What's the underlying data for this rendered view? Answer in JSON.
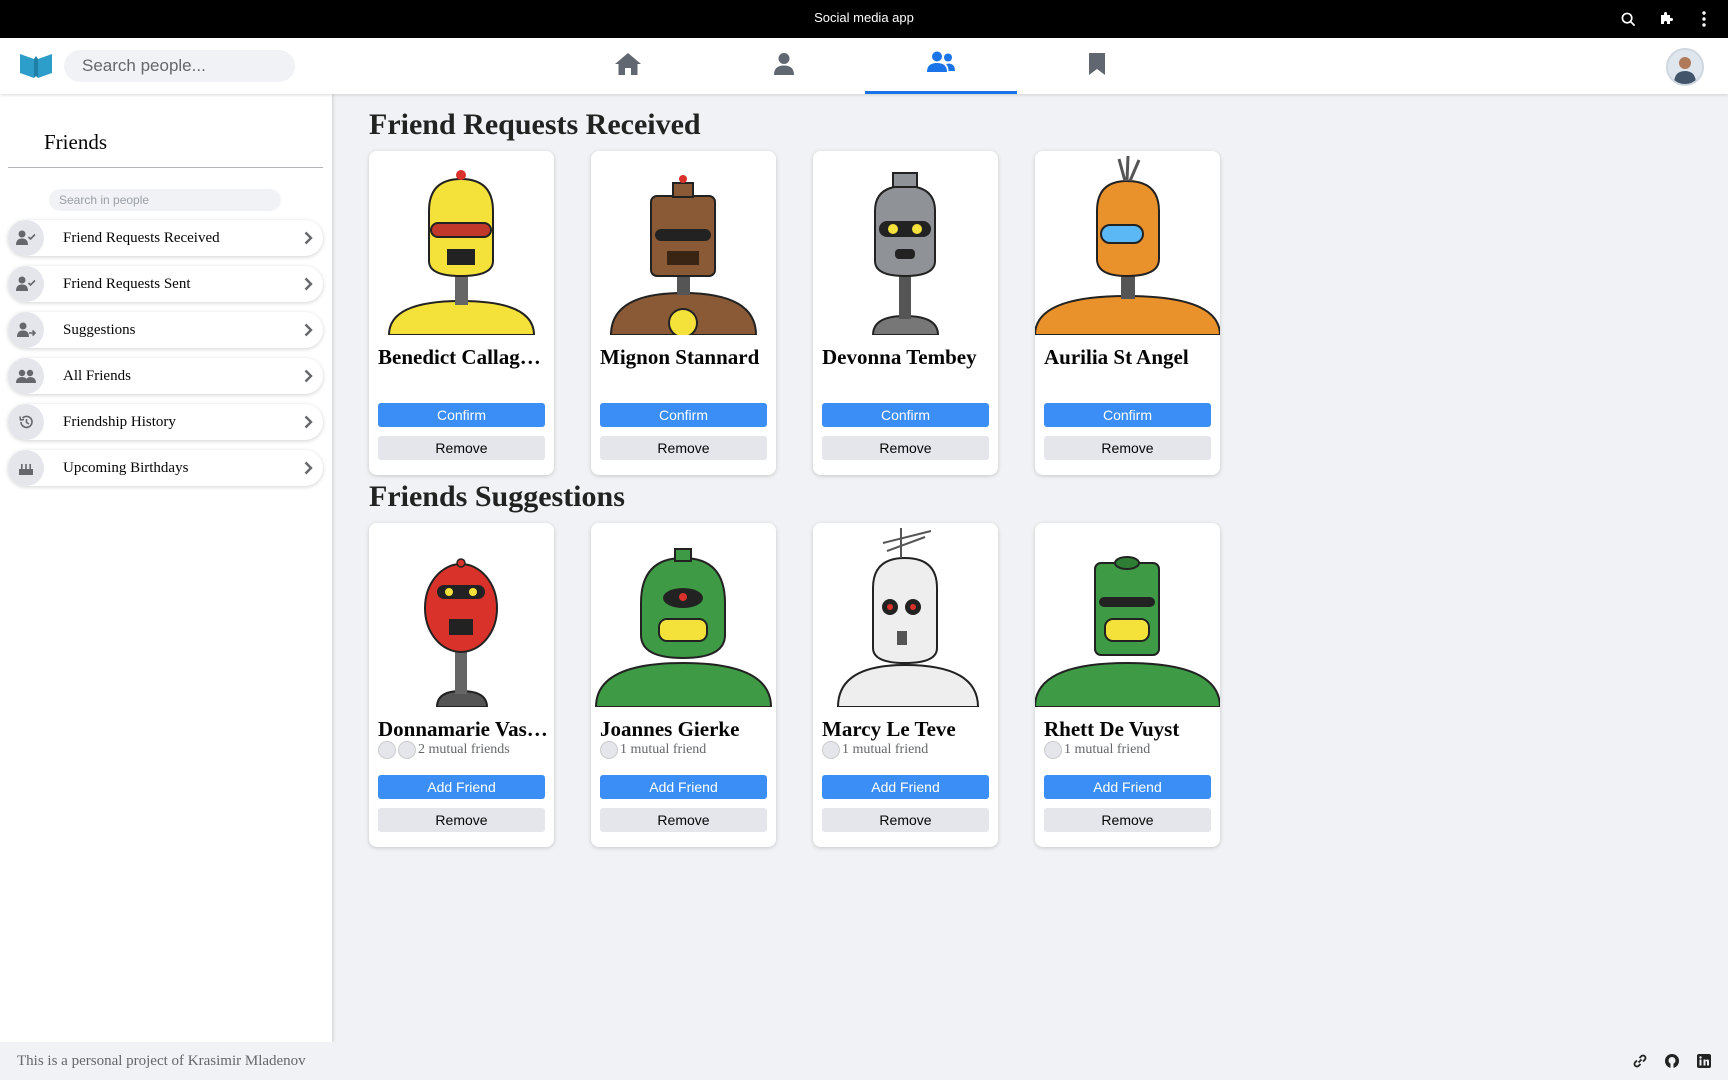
{
  "window": {
    "title": "Social media app"
  },
  "navbar": {
    "search_placeholder": "Search people...",
    "tabs": [
      {
        "icon": "home-icon",
        "active": false
      },
      {
        "icon": "user-icon",
        "active": false
      },
      {
        "icon": "users-icon",
        "active": true
      },
      {
        "icon": "bookmark-icon",
        "active": false
      }
    ],
    "accent": "#1a73e8"
  },
  "sidebar": {
    "title": "Friends",
    "search_placeholder": "Search in people",
    "items": [
      {
        "label": "Friend Requests Received",
        "icon": "user-check-icon"
      },
      {
        "label": "Friend Requests Sent",
        "icon": "user-check-icon"
      },
      {
        "label": "Suggestions",
        "icon": "user-plus-icon"
      },
      {
        "label": "All Friends",
        "icon": "users-icon"
      },
      {
        "label": "Friendship History",
        "icon": "history-icon"
      },
      {
        "label": "Upcoming Birthdays",
        "icon": "cake-icon"
      }
    ]
  },
  "requests": {
    "title": "Friend Requests Received",
    "confirm_label": "Confirm",
    "remove_label": "Remove",
    "cards": [
      {
        "name": "Benedict Callaghan",
        "color": "#f4e23a"
      },
      {
        "name": "Mignon Stannard",
        "color": "#8a5a36"
      },
      {
        "name": "Devonna Tembey",
        "color": "#8f9296"
      },
      {
        "name": "Aurilia St Angel",
        "color": "#e9912b"
      }
    ]
  },
  "suggestions": {
    "title": "Friends Suggestions",
    "add_label": "Add Friend",
    "remove_label": "Remove",
    "cards": [
      {
        "name": "Donnamarie Vasilchenko",
        "mutual": "2 mutual friends",
        "mutual_count": 2,
        "color": "#d9322b"
      },
      {
        "name": "Joannes Gierke",
        "mutual": "1 mutual friend",
        "mutual_count": 1,
        "color": "#3e9a45"
      },
      {
        "name": "Marcy Le Teve",
        "mutual": "1 mutual friend",
        "mutual_count": 1,
        "color": "#eeeeee"
      },
      {
        "name": "Rhett De Vuyst",
        "mutual": "1 mutual friend",
        "mutual_count": 1,
        "color": "#3e9a45"
      }
    ]
  },
  "footer": {
    "text": "This is a personal project of Krasimir Mladenov"
  }
}
